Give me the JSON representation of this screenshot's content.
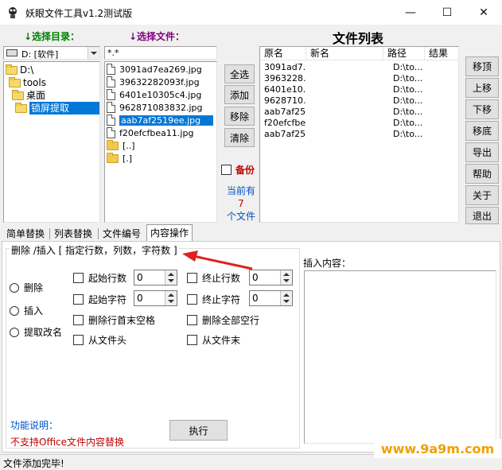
{
  "window": {
    "title": "妖眼文件工具v1.2测试版",
    "minimize_label": "—",
    "maximize_label": "☐",
    "close_label": "✕"
  },
  "left_panel": {
    "dir_label": "↓选择目录：",
    "drive_select_value": "D: [软件]",
    "tree": [
      {
        "label": "D:\\",
        "level": 0,
        "selected": false
      },
      {
        "label": "tools",
        "level": 1,
        "selected": false
      },
      {
        "label": "桌面",
        "level": 2,
        "selected": false
      },
      {
        "label": "锁屏提取",
        "level": 3,
        "selected": true
      }
    ]
  },
  "file_panel": {
    "file_label": "↓选择文件：",
    "filter_value": "*.*",
    "files": [
      {
        "name": "3091ad7ea269.jpg",
        "type": "file",
        "selected": false
      },
      {
        "name": "39632282093f.jpg",
        "type": "file",
        "selected": false
      },
      {
        "name": "6401e10305c4.jpg",
        "type": "file",
        "selected": false
      },
      {
        "name": "962871083832.jpg",
        "type": "file",
        "selected": false
      },
      {
        "name": "aab7af2519ee.jpg",
        "type": "file",
        "selected": true
      },
      {
        "name": "f20efcfbea11.jpg",
        "type": "file",
        "selected": false
      },
      {
        "name": "[..]",
        "type": "folder",
        "selected": false
      },
      {
        "name": "[.]",
        "type": "folder",
        "selected": false
      }
    ]
  },
  "middle_buttons": {
    "select_all": "全选",
    "add": "添加",
    "remove": "移除",
    "clear": "清除",
    "backup_label": "备份",
    "count_line1": "当前有",
    "count_value": "7",
    "count_line2": "个文件"
  },
  "file_list": {
    "title": "文件列表",
    "columns": [
      "原名",
      "新名",
      "路径",
      "结果"
    ],
    "rows": [
      {
        "orig": "3091ad7...",
        "new": "",
        "path": "D:\\to...",
        "result": ""
      },
      {
        "orig": "3963228...",
        "new": "",
        "path": "D:\\to...",
        "result": ""
      },
      {
        "orig": "6401e10...",
        "new": "",
        "path": "D:\\to...",
        "result": ""
      },
      {
        "orig": "9628710...",
        "new": "",
        "path": "D:\\to...",
        "result": ""
      },
      {
        "orig": "aab7af25...",
        "new": "",
        "path": "D:\\to...",
        "result": ""
      },
      {
        "orig": "f20efcfbe...",
        "new": "",
        "path": "D:\\to...",
        "result": ""
      },
      {
        "orig": "aab7af25...",
        "new": "",
        "path": "D:\\to...",
        "result": ""
      }
    ]
  },
  "right_buttons": {
    "top": "移顶",
    "up": "上移",
    "down": "下移",
    "bottom": "移底",
    "export": "导出",
    "help": "帮助",
    "about": "关于",
    "exit": "退出"
  },
  "tabs": [
    "简单替换",
    "列表替换",
    "文件编号",
    "内容操作"
  ],
  "content_op": {
    "group_title": "删除 /插入 [ 指定行数，列数，字符数 ]",
    "radio_delete": "删除",
    "radio_insert": "插入",
    "radio_extract": "提取改名",
    "start_line_label": "起始行数",
    "start_line_value": "0",
    "end_line_label": "终止行数",
    "end_line_value": "0",
    "start_char_label": "起始字符",
    "start_char_value": "0",
    "end_char_label": "终止字符",
    "end_char_value": "0",
    "trim_label": "删除行首末空格",
    "delete_empty_label": "删除全部空行",
    "from_head_label": "从文件头",
    "from_tail_label": "从文件末",
    "insert_content_label": "插入内容：",
    "func_desc_label": "功能说明：",
    "func_desc_text": "不支持Office文件内容替换",
    "execute": "执行"
  },
  "status": {
    "text": "文件添加完毕!"
  },
  "watermark": "www.9a9m.com",
  "colors": {
    "accent": "#0078d7",
    "green": "#008000",
    "purple": "#800080",
    "red_text": "#c00000",
    "arrow": "#e0201c",
    "watermark_bg": "#ffffff",
    "watermark_fg": "#f0a000"
  }
}
